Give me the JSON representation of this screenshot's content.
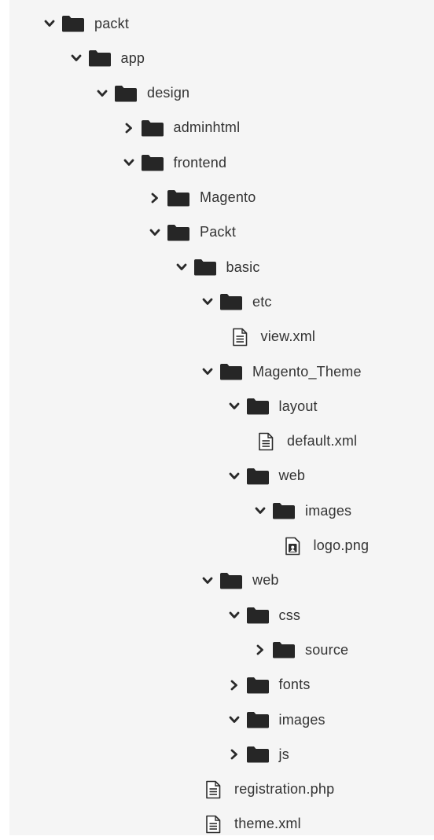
{
  "tree": {
    "items": [
      {
        "name": "packt",
        "kind": "folder",
        "state": "expanded",
        "depth": 0
      },
      {
        "name": "app",
        "kind": "folder",
        "state": "expanded",
        "depth": 1
      },
      {
        "name": "design",
        "kind": "folder",
        "state": "expanded",
        "depth": 2
      },
      {
        "name": "adminhtml",
        "kind": "folder",
        "state": "collapsed",
        "depth": 3
      },
      {
        "name": "frontend",
        "kind": "folder",
        "state": "expanded",
        "depth": 3
      },
      {
        "name": "Magento",
        "kind": "folder",
        "state": "collapsed",
        "depth": 4
      },
      {
        "name": "Packt",
        "kind": "folder",
        "state": "expanded",
        "depth": 4
      },
      {
        "name": "basic",
        "kind": "folder",
        "state": "expanded",
        "depth": 5
      },
      {
        "name": "etc",
        "kind": "folder",
        "state": "expanded",
        "depth": 6
      },
      {
        "name": "view.xml",
        "kind": "file",
        "icon": "document-icon",
        "depth": 7
      },
      {
        "name": "Magento_Theme",
        "kind": "folder",
        "state": "expanded",
        "depth": 6
      },
      {
        "name": "layout",
        "kind": "folder",
        "state": "expanded",
        "depth": 7
      },
      {
        "name": "default.xml",
        "kind": "file",
        "icon": "document-icon",
        "depth": 8
      },
      {
        "name": "web",
        "kind": "folder",
        "state": "expanded",
        "depth": 7
      },
      {
        "name": "images",
        "kind": "folder",
        "state": "expanded",
        "depth": 8
      },
      {
        "name": "logo.png",
        "kind": "file",
        "icon": "image-file-icon",
        "depth": 9
      },
      {
        "name": "web",
        "kind": "folder",
        "state": "expanded",
        "depth": 6
      },
      {
        "name": "css",
        "kind": "folder",
        "state": "expanded",
        "depth": 7
      },
      {
        "name": "source",
        "kind": "folder",
        "state": "collapsed",
        "depth": 8
      },
      {
        "name": "fonts",
        "kind": "folder",
        "state": "collapsed",
        "depth": 7
      },
      {
        "name": "images",
        "kind": "folder",
        "state": "expanded",
        "depth": 7
      },
      {
        "name": "js",
        "kind": "folder",
        "state": "collapsed",
        "depth": 7
      },
      {
        "name": "registration.php",
        "kind": "file",
        "icon": "document-icon",
        "depth": 6
      },
      {
        "name": "theme.xml",
        "kind": "file",
        "icon": "document-icon",
        "depth": 6
      }
    ]
  },
  "colors": {
    "panel_background": "#f5f5f5",
    "folder": "#262626",
    "chevron": "#2a2a2a",
    "file_outline": "#2e2e2e",
    "label_text": "#333333"
  }
}
